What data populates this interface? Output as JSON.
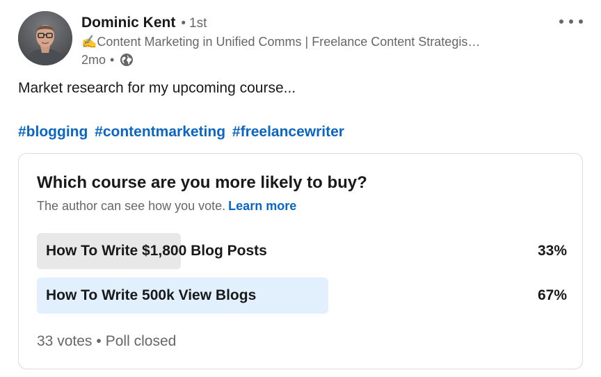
{
  "author": {
    "name": "Dominic Kent",
    "degree": "1st",
    "headline": "✍️Content Marketing in Unified Comms | Freelance Content Strategis…",
    "time": "2mo",
    "visibility_icon": "globe-icon"
  },
  "post": {
    "text": "Market research for my upcoming course...",
    "hashtags": [
      "#blogging",
      "#contentmarketing",
      "#freelancewriter"
    ]
  },
  "poll": {
    "question": "Which course are you more likely to buy?",
    "note": "The author can see how you vote.",
    "learn_more": "Learn more",
    "options": [
      {
        "label": "How To Write $1,800 Blog Posts",
        "percent_text": "33%",
        "percent": 33,
        "bar_color": "#e8e8e8",
        "winner": false
      },
      {
        "label": "How To Write 500k View Blogs",
        "percent_text": "67%",
        "percent": 67,
        "bar_color": "#e2f0fe",
        "winner": true
      }
    ],
    "votes": "33 votes",
    "status": "Poll closed"
  },
  "colors": {
    "link": "#0a66c2",
    "text": "#191919",
    "muted": "#666666"
  }
}
